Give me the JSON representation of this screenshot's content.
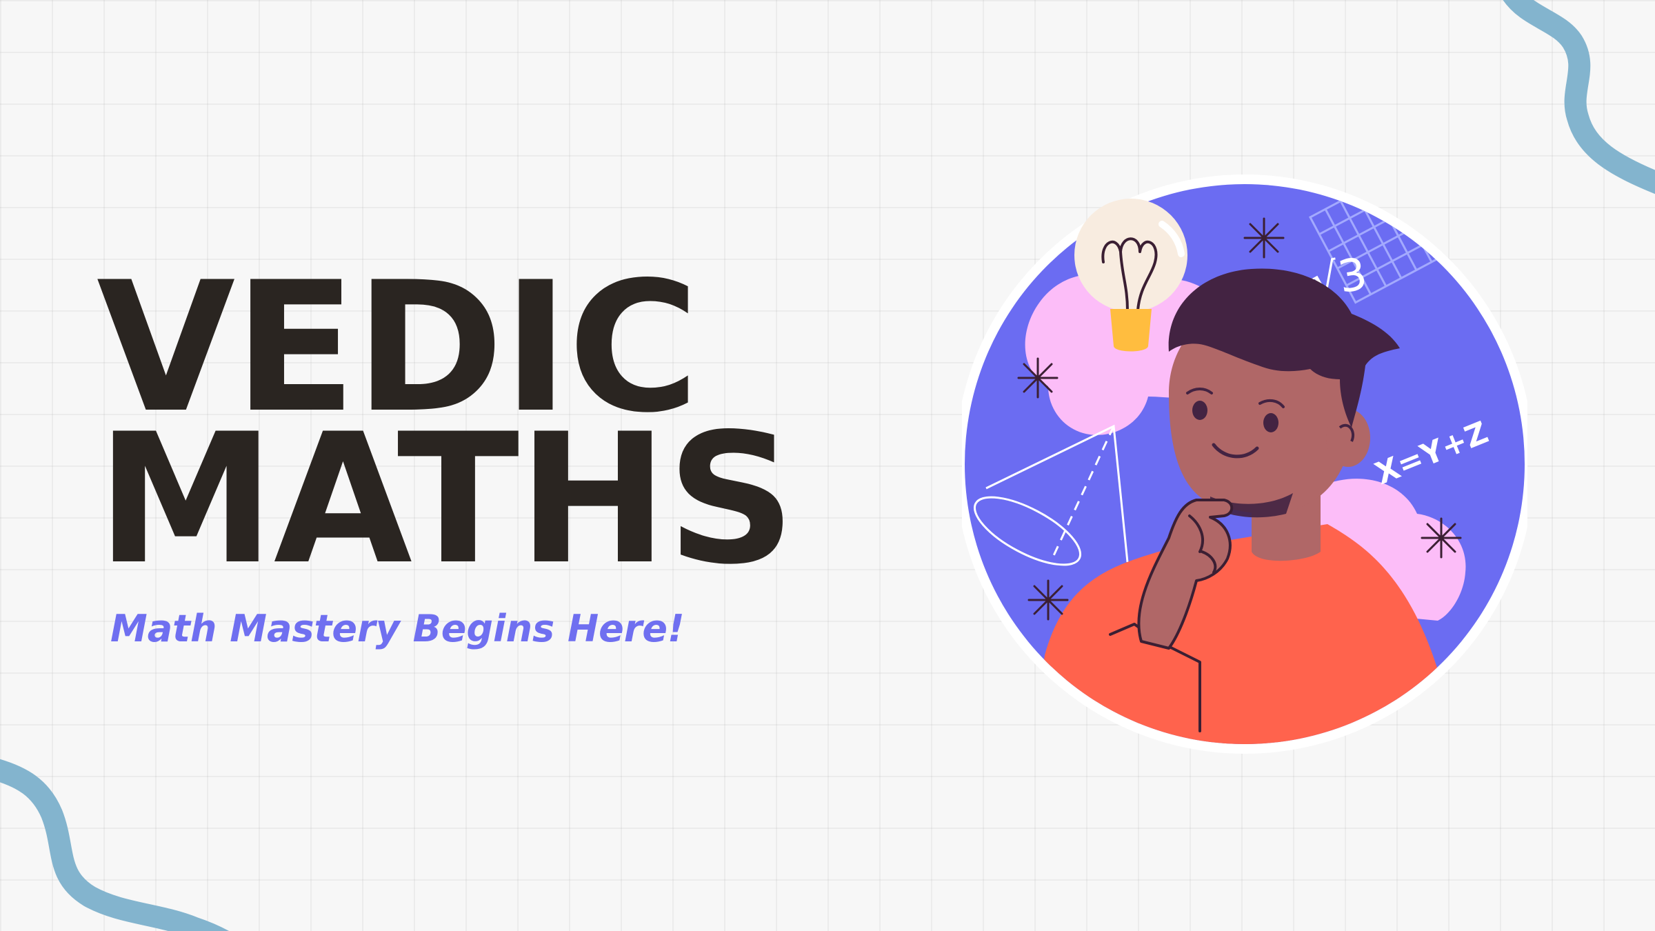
{
  "title": {
    "line1": "VEDIC",
    "line2": "MATHS"
  },
  "subtitle": "Math Mastery Begins Here!",
  "illustration": {
    "sqrt_label": "√3",
    "equation_label": "X=Y+Z"
  },
  "colors": {
    "background": "#f7f7f7",
    "title": "#2a2521",
    "subtitle": "#6f6ff0",
    "circle": "#6b6cf2",
    "cloud": "#fcbdf8",
    "shirt": "#ff634d",
    "skin": "#b06767",
    "hair": "#432342",
    "squiggle": "#83b4ce",
    "bulb_glass": "#f8ece0",
    "bulb_base": "#ffbd3f"
  },
  "icons": [
    "lightbulb-icon",
    "sparkle-icon",
    "cone-icon",
    "sqrt-grid-icon"
  ]
}
